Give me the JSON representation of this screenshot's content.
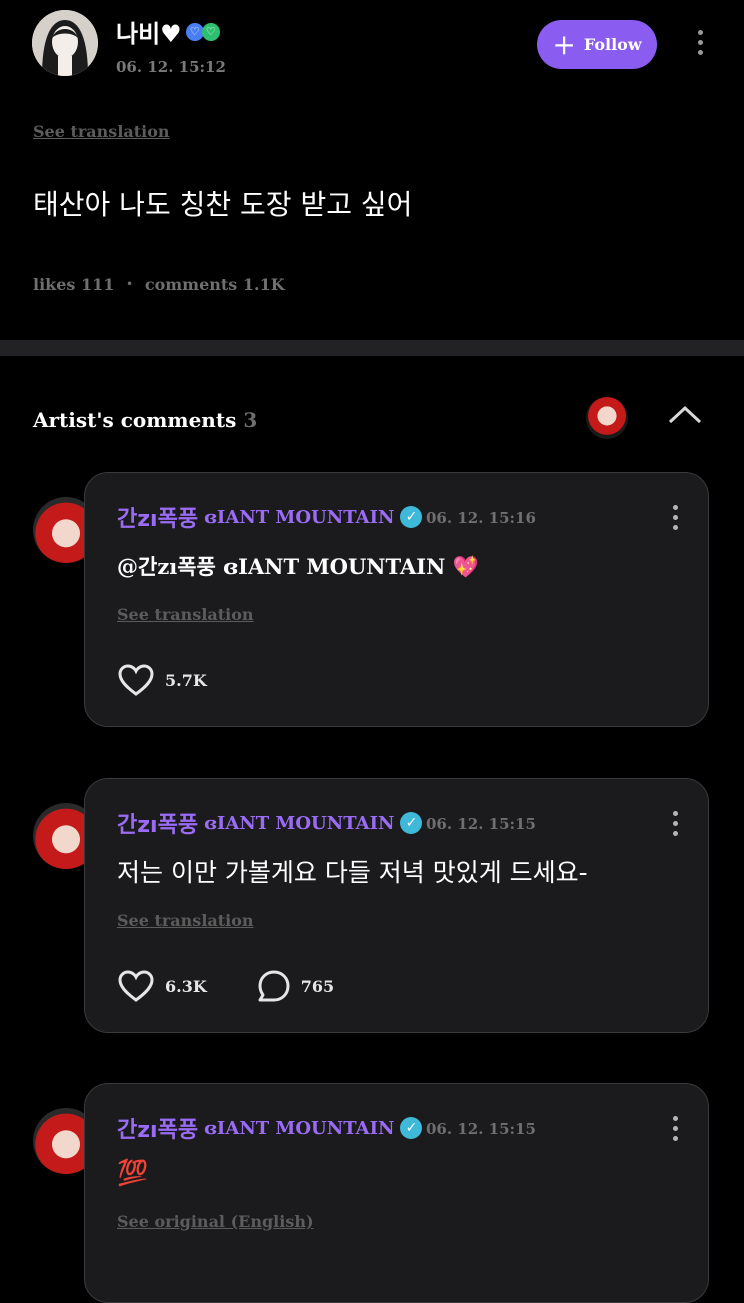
{
  "post": {
    "author": "나비♥",
    "time": "06. 12. 15:12",
    "follow_label": "Follow",
    "see_translation": "See translation",
    "body": "태산아 나도 칭찬 도장 받고 싶어",
    "likes_label": "likes",
    "likes_count": "111",
    "stat_separator": "•",
    "comments_label": "comments",
    "comments_count": "1.1K"
  },
  "section": {
    "title": "Artist's comments",
    "count": "3"
  },
  "comments": [
    {
      "name_ko": "간zı폭풍",
      "name_en": "ɞIANT MOUNTAIN",
      "time": "06. 12. 15:16",
      "body": "@간zı폭풍 ɞIANT MOUNTAIN 💖",
      "translation": "See translation",
      "likes": "5.7K"
    },
    {
      "name_ko": "간zı폭풍",
      "name_en": "ɞIANT MOUNTAIN",
      "time": "06. 12. 15:15",
      "body": "저는 이만 가볼게요 다들 저녁 맛있게 드세요-",
      "translation": "See translation",
      "likes": "6.3K",
      "replies": "765"
    },
    {
      "name_ko": "간zı폭풍",
      "name_en": "ɞIANT MOUNTAIN",
      "time": "06. 12. 15:15",
      "body": "💯",
      "translation": "See original (English)"
    }
  ],
  "colors": {
    "accent": "#8a5cf0",
    "artist_name": "#9a6cf5",
    "verified": "#3fb9d8",
    "card_bg": "#1b1b1d"
  }
}
